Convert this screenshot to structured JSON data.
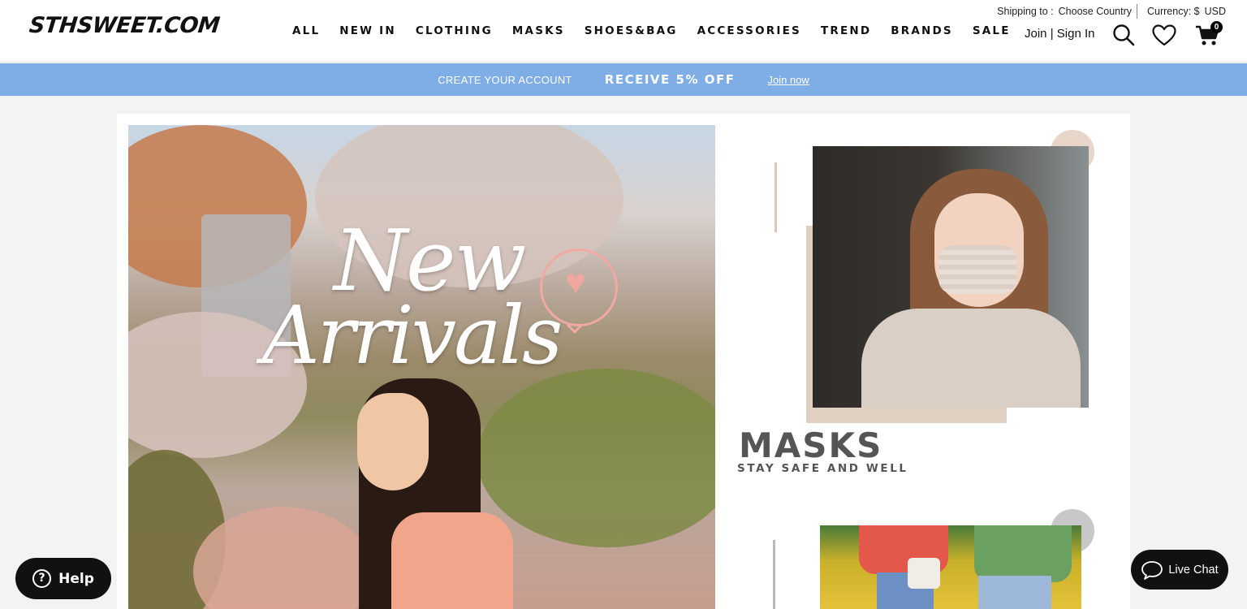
{
  "header": {
    "logo": "STHSWEET.COM",
    "nav": [
      "ALL",
      "NEW IN",
      "CLOTHING",
      "MASKS",
      "SHOES&BAG",
      "ACCESSORIES",
      "TREND",
      "BRANDS",
      "SALE"
    ],
    "shipping_label": "Shipping to :",
    "shipping_value": "Choose Country",
    "currency_label": "Currency: $",
    "currency_value": "USD",
    "join": "Join",
    "auth_sep": "|",
    "sign_in": "Sign In",
    "cart_count": "0",
    "icons": [
      "search-icon",
      "heart-icon",
      "cart-icon"
    ]
  },
  "promo": {
    "left": "CREATE YOUR ACCOUNT",
    "middle": "RECEIVE 5% OFF",
    "link": "Join now",
    "bg_color": "#7faee6"
  },
  "hero": {
    "line1": "New",
    "line2": "Arrivals"
  },
  "masks": {
    "title": "MASKS",
    "subtitle": "STAY SAFE AND WELL"
  },
  "floating": {
    "help": "Help",
    "live_chat": "Live Chat"
  }
}
